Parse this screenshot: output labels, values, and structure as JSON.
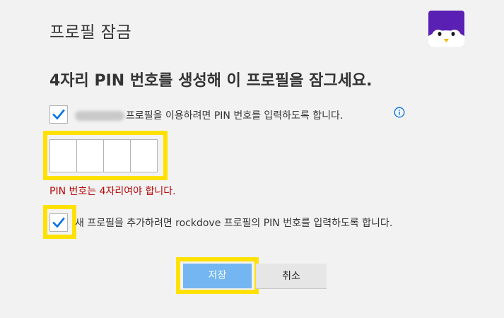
{
  "page": {
    "title": "프로필 잠금",
    "heading": "4자리 PIN 번호를 생성해 이 프로필을 잠그세요."
  },
  "avatar": {
    "icon": "penguin-avatar-icon",
    "color": "#5a1fb3"
  },
  "options": {
    "require_pin": {
      "checked": true,
      "label": "프로필을 이용하려면 PIN 번호를 입력하도록 합니다."
    },
    "require_pin_new_profile": {
      "checked": true,
      "label": "새 프로필을 추가하려면 rockdove 프로필의 PIN 번호를 입력하도록 합니다."
    }
  },
  "pin": {
    "digits": [
      "",
      "",
      "",
      ""
    ]
  },
  "error": {
    "message": "PIN 번호는 4자리여야 합니다."
  },
  "buttons": {
    "save_label": "저장",
    "cancel_label": "취소"
  },
  "colors": {
    "checkmark": "#0071eb",
    "highlight": "#ffe100",
    "error": "#b9090b",
    "save_button": "#73b6f1"
  }
}
